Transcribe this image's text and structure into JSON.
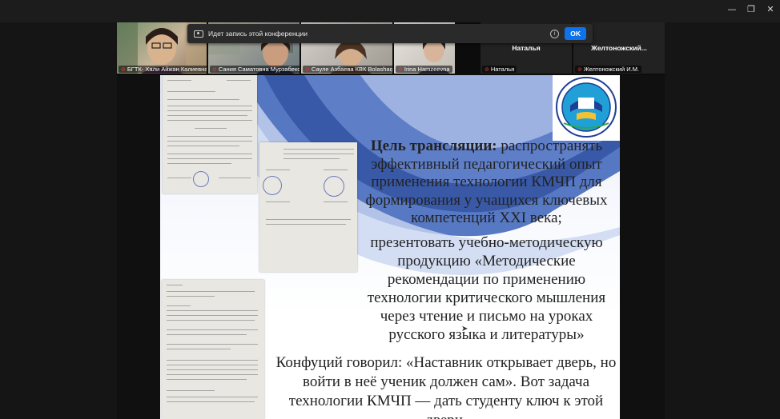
{
  "window": {
    "controls": {
      "minimize": "—",
      "restore": "❐",
      "close": "✕"
    }
  },
  "banner": {
    "text": "Идет запись этой конференции",
    "info": "i",
    "ok_label": "OK"
  },
  "participants": [
    {
      "name": "БГТК- Хали Айжан Калиевна"
    },
    {
      "name": "Сания Саматовна Мурзабекова"
    },
    {
      "name": "Сауле Азбаева КВК Bolashaq"
    },
    {
      "name": "Irina Hamzeevna"
    },
    {
      "name": "Наталья",
      "display": "Наталья"
    },
    {
      "name": "Желтоножский И.М.",
      "display": "Желтоножский..."
    }
  ],
  "slide": {
    "goal_heading": "Цель трансляции:",
    "goal_body": "распространять эффективный педагогический опыт применения технологии КМЧП для формирования у учащихся ключевых компетенций XXI века;",
    "present_body": "презентовать учебно-методическую продукцию «Методические рекомендации по применению технологии критического мышления через чтение и письмо на уроках русского языка и литературы»",
    "quote": "Конфуций говорил: «Наставник открывает дверь, но войти в неё ученик должен сам». Вот задача технологии КМЧП — дать студенту ключ к этой двери."
  },
  "colors": {
    "accent": "#0e72ed",
    "mic_muted": "#e23b3b"
  }
}
